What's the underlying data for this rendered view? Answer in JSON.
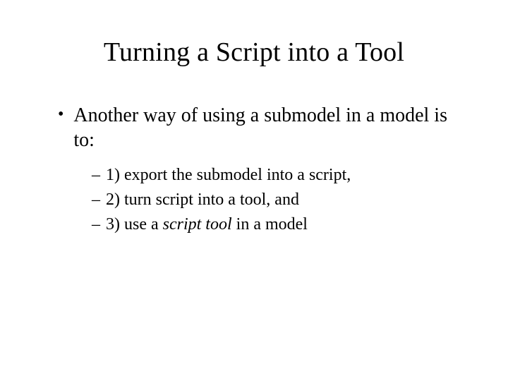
{
  "title": "Turning a Script into a Tool",
  "bullet1": {
    "marker": "•",
    "text": "Another way of using a submodel in a model is to:"
  },
  "sub": {
    "marker": "–",
    "item1": "1) export the submodel into a script,",
    "item2": "2) turn script into a tool, and",
    "item3_prefix": "3) use a ",
    "item3_italic": "script tool",
    "item3_suffix": " in a model"
  }
}
